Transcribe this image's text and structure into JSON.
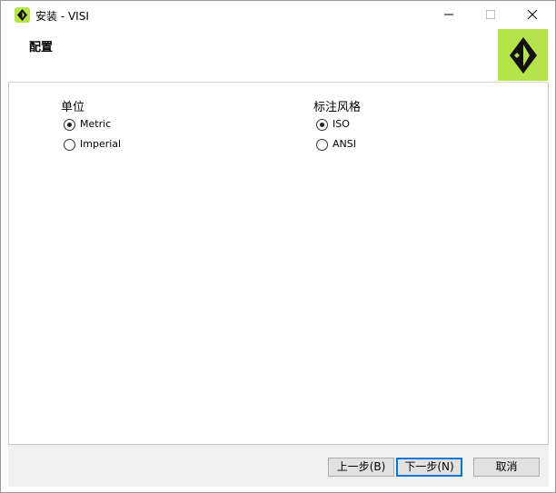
{
  "window": {
    "title": "安装 - VISI",
    "icon": "visi-diamond-icon"
  },
  "header": {
    "title": "配置",
    "logo": "visi-logo-icon"
  },
  "units": {
    "label": "单位",
    "options": [
      {
        "label": "Metric",
        "checked": true
      },
      {
        "label": "Imperial",
        "checked": false
      }
    ]
  },
  "dimension_style": {
    "label": "标注风格",
    "options": [
      {
        "label": "ISO",
        "checked": true
      },
      {
        "label": "ANSI",
        "checked": false
      }
    ]
  },
  "footer": {
    "back_label": "上一步(B)",
    "next_label": "下一步(N)",
    "cancel_label": "取消"
  },
  "colors": {
    "brand": "#b7e34a",
    "default_button_border": "#0078d7"
  }
}
